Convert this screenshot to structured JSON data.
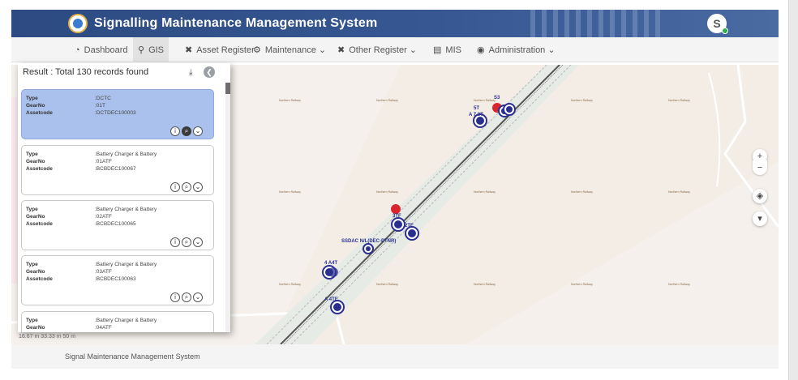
{
  "app": {
    "title": "Signalling Maintenance Management System",
    "avatar_initial": "S"
  },
  "nav": {
    "items": [
      {
        "label": "Dashboard",
        "icon": "dashboard-icon"
      },
      {
        "label": "GIS",
        "icon": "map-pin-icon"
      },
      {
        "label": "Asset Register",
        "icon": "tools-icon"
      },
      {
        "label": "Maintenance ⌄",
        "icon": "gear-icon"
      },
      {
        "label": "Other Register ⌄",
        "icon": "tools-icon"
      },
      {
        "label": "MIS",
        "icon": "report-icon"
      },
      {
        "label": "Administration ⌄",
        "icon": "admin-icon"
      }
    ]
  },
  "results": {
    "summary": "Result : Total 130 records found",
    "field_labels": {
      "type": "Type",
      "gear": "GearNo",
      "asset": "Assetcode"
    },
    "records": [
      {
        "type": ":DCTC",
        "gear": ":01T",
        "asset": ":DCTDEC100003"
      },
      {
        "type": ":Battery Charger & Battery",
        "gear": ":01ATF",
        "asset": ":BCBDEC100067"
      },
      {
        "type": ":Battery Charger & Battery",
        "gear": ":02ATF",
        "asset": ":BCBDEC100065"
      },
      {
        "type": ":Battery Charger & Battery",
        "gear": ":03ATF",
        "asset": ":BCBDEC100063"
      },
      {
        "type": ":Battery Charger & Battery",
        "gear": ":04ATF",
        "asset": ""
      }
    ]
  },
  "map": {
    "region_label": "Northern Railway",
    "markers": [
      "S3",
      "5T",
      "A 7 3T",
      "3TF",
      "2TF",
      "SSDAC N/L(DEC-PTNR)",
      "4 A4T",
      "A 4TF"
    ],
    "scale_text": "16.67 m  33.33 m  50 m",
    "controls": {
      "zoom_in": "+",
      "zoom_out": "−"
    }
  },
  "footer": {
    "text": "Signal Maintenance Management System"
  },
  "colors": {
    "header": "#2d4b82",
    "selected_card": "#a9c1ec",
    "marker_blue": "#2a2f8f",
    "marker_red": "#d9262e"
  }
}
